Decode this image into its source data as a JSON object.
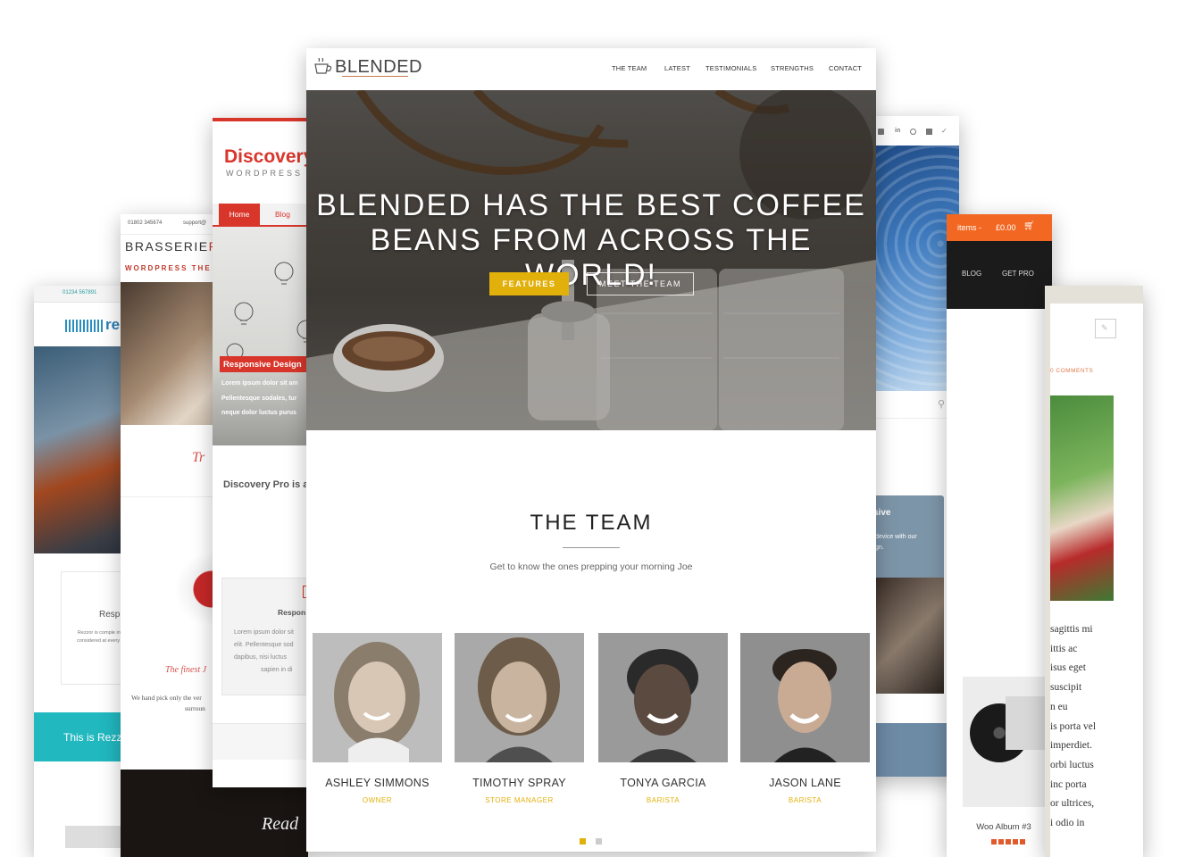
{
  "rezzie": {
    "phone": "01234 567891",
    "logo_text": "re",
    "card_title": "Resp",
    "card_text": "Rezzor is comple including the huge considered at every yourself a visit w",
    "banner_text": "This is Rezz"
  },
  "brasserie": {
    "phone": "01802 345674",
    "email": "support@",
    "logo_prefix": "BRASSERIE",
    "logo_suffix": "P",
    "tagline": "WORDPRESS THE",
    "script_heading": "The finest J",
    "body_text_1": "We hand pick only the ver",
    "body_text_2": "surroun",
    "footer_script": "Read"
  },
  "discovery": {
    "logo": "Discovery",
    "tagline": "WORDPRESS",
    "nav": [
      "Home",
      "Blog"
    ],
    "slide_title": "Responsive Design",
    "slide_text_1": "Lorem ipsum dolor sit am",
    "slide_text_2": "Pellentesque sodales, tur",
    "slide_text_3": "neque dolor luctus purus",
    "intro": "Discovery Pro is a",
    "box_title": "Respon",
    "box_text_1": "elit. Pellentesque sod",
    "box_text_2": "dapibus, nisi luctus",
    "box_text_3": "sapien in di",
    "box_text_0": "Lorem ipsum dolor sit"
  },
  "right1": {
    "panel_title": "sive",
    "panel_text_1": "device with our",
    "panel_text_2": "gn."
  },
  "right2": {
    "cart_label": "items -",
    "cart_price": "£0.00",
    "nav": [
      "BLOG",
      "GET PRO"
    ],
    "product_title": "Woo Album #3"
  },
  "right3": {
    "comments": "0 COMMENTS",
    "text_lines": [
      "sagittis mi",
      "ittis ac",
      "isus eget",
      "suscipit",
      "n eu",
      "is porta vel",
      "imperdiet.",
      "orbi luctus",
      "inc porta",
      "or ultrices,",
      "i odio in"
    ]
  },
  "main": {
    "logo": "BLENDED",
    "nav": [
      "THE TEAM",
      "LATEST",
      "TESTIMONIALS",
      "STRENGTHS",
      "CONTACT"
    ],
    "hero_line1": "BLENDED HAS THE BEST COFFEE",
    "hero_line2": "BEANS FROM ACROSS THE WORLD!",
    "btn_features": "FEATURES",
    "btn_meet": "MEET THE TEAM",
    "team_title": "THE TEAM",
    "team_subtitle": "Get to know the ones prepping your morning Joe",
    "members": [
      {
        "name": "ASHLEY SIMMONS",
        "role": "OWNER"
      },
      {
        "name": "TIMOTHY SPRAY",
        "role": "STORE MANAGER"
      },
      {
        "name": "TONYA GARCIA",
        "role": "BARISTA"
      },
      {
        "name": "JASON LANE",
        "role": "BARISTA"
      }
    ]
  },
  "colors": {
    "accent_gold": "#e2b00b",
    "discovery_red": "#d9362b",
    "rezzie_teal": "#21b8c0",
    "shop_orange": "#f26722"
  }
}
